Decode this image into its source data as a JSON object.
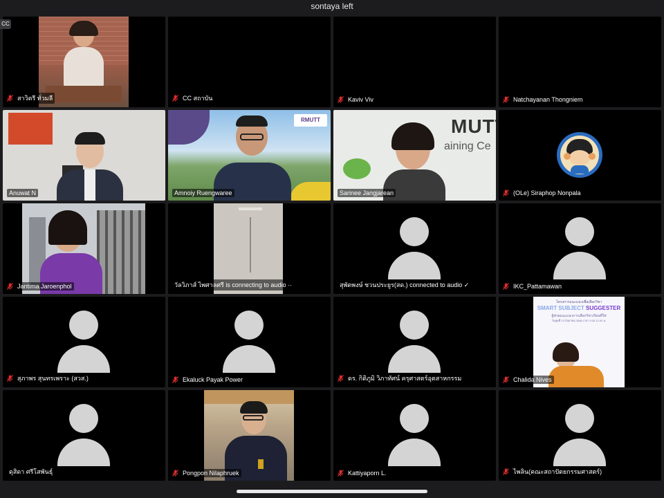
{
  "window": {
    "title": "sontaya left",
    "cc_badge": "CC"
  },
  "participants": [
    {
      "name": "สาวิตรี ทั่วมลี",
      "muted": true,
      "video": "woman-brick"
    },
    {
      "name": "CC สถาบัน",
      "muted": true,
      "video": "none-blank"
    },
    {
      "name": "Kaviv Viv",
      "muted": true,
      "video": "none-blank"
    },
    {
      "name": "Natchayanan Thongniem",
      "muted": true,
      "video": "none-blank"
    },
    {
      "name": "Anuwat N",
      "muted": false,
      "video": "man-office"
    },
    {
      "name": "Amnoiy Ruengwaree",
      "muted": false,
      "video": "man-campus",
      "active": true
    },
    {
      "name": "Sarinee Jangjarean",
      "muted": false,
      "video": "woman-rmutt"
    },
    {
      "name": "(OLe) Siraphop Nonpala",
      "muted": true,
      "video": "cartoon-avatar"
    },
    {
      "name": "Jantima Jaroenphol",
      "muted": true,
      "video": "woman-library"
    },
    {
      "name": "วัลวิภาส์ ไพศาลศรี is connecting to audio ··",
      "muted": false,
      "video": "wall-lamp"
    },
    {
      "name": "สุพัตพงษ์ ชวนประยูร(สด.) connected to audio ✓",
      "muted": false,
      "video": "placeholder"
    },
    {
      "name": "IKC_Pattamawan",
      "muted": true,
      "video": "placeholder"
    },
    {
      "name": "สุภาพร สุนทรเพราะ (สวส.)",
      "muted": true,
      "video": "placeholder"
    },
    {
      "name": "Ekaluck Payak Power",
      "muted": true,
      "video": "placeholder"
    },
    {
      "name": "ดร. กิติภูมิ วิภาทัศน์ ครุศาสตร์อุตสาหกรรม",
      "muted": true,
      "video": "placeholder"
    },
    {
      "name": "Chalida Nives",
      "muted": true,
      "video": "poster"
    },
    {
      "name": "ดุสิดา ศรีโสพันธุ์",
      "muted": false,
      "video": "placeholder"
    },
    {
      "name": "Pongpon Nilaphruek",
      "muted": true,
      "video": "man-hall"
    },
    {
      "name": "Kattiyaporn L.",
      "muted": true,
      "video": "placeholder"
    },
    {
      "name": "ไพลิน(คณะสถาปัตยกรรมศาสตร์)",
      "muted": true,
      "video": "placeholder"
    }
  ],
  "rmutt_sign": "MUTT",
  "rmutt_sign_sub": "aining Ce",
  "campus_logo": "RMUTT",
  "poster": {
    "header": "โครงการแนะแนวเพื่อเลือกวิชา",
    "title_a": "SMART SUBJECT ",
    "title_b": "SUGGESTER",
    "subtitle": "ผู้ช่วยแนะแนวการเลือกวิชาเรียนที่ใช่",
    "date": "วันพุธที่ 13 กันยายน 2566 เวลา 9.30-12.00 น."
  },
  "colors": {
    "active_border": "#35c35a",
    "muted_icon": "#e02e2e",
    "avatar": "#d4d4d4"
  },
  "icons": {
    "muted_mic": "muted-mic-icon",
    "avatar": "avatar-placeholder-icon"
  }
}
